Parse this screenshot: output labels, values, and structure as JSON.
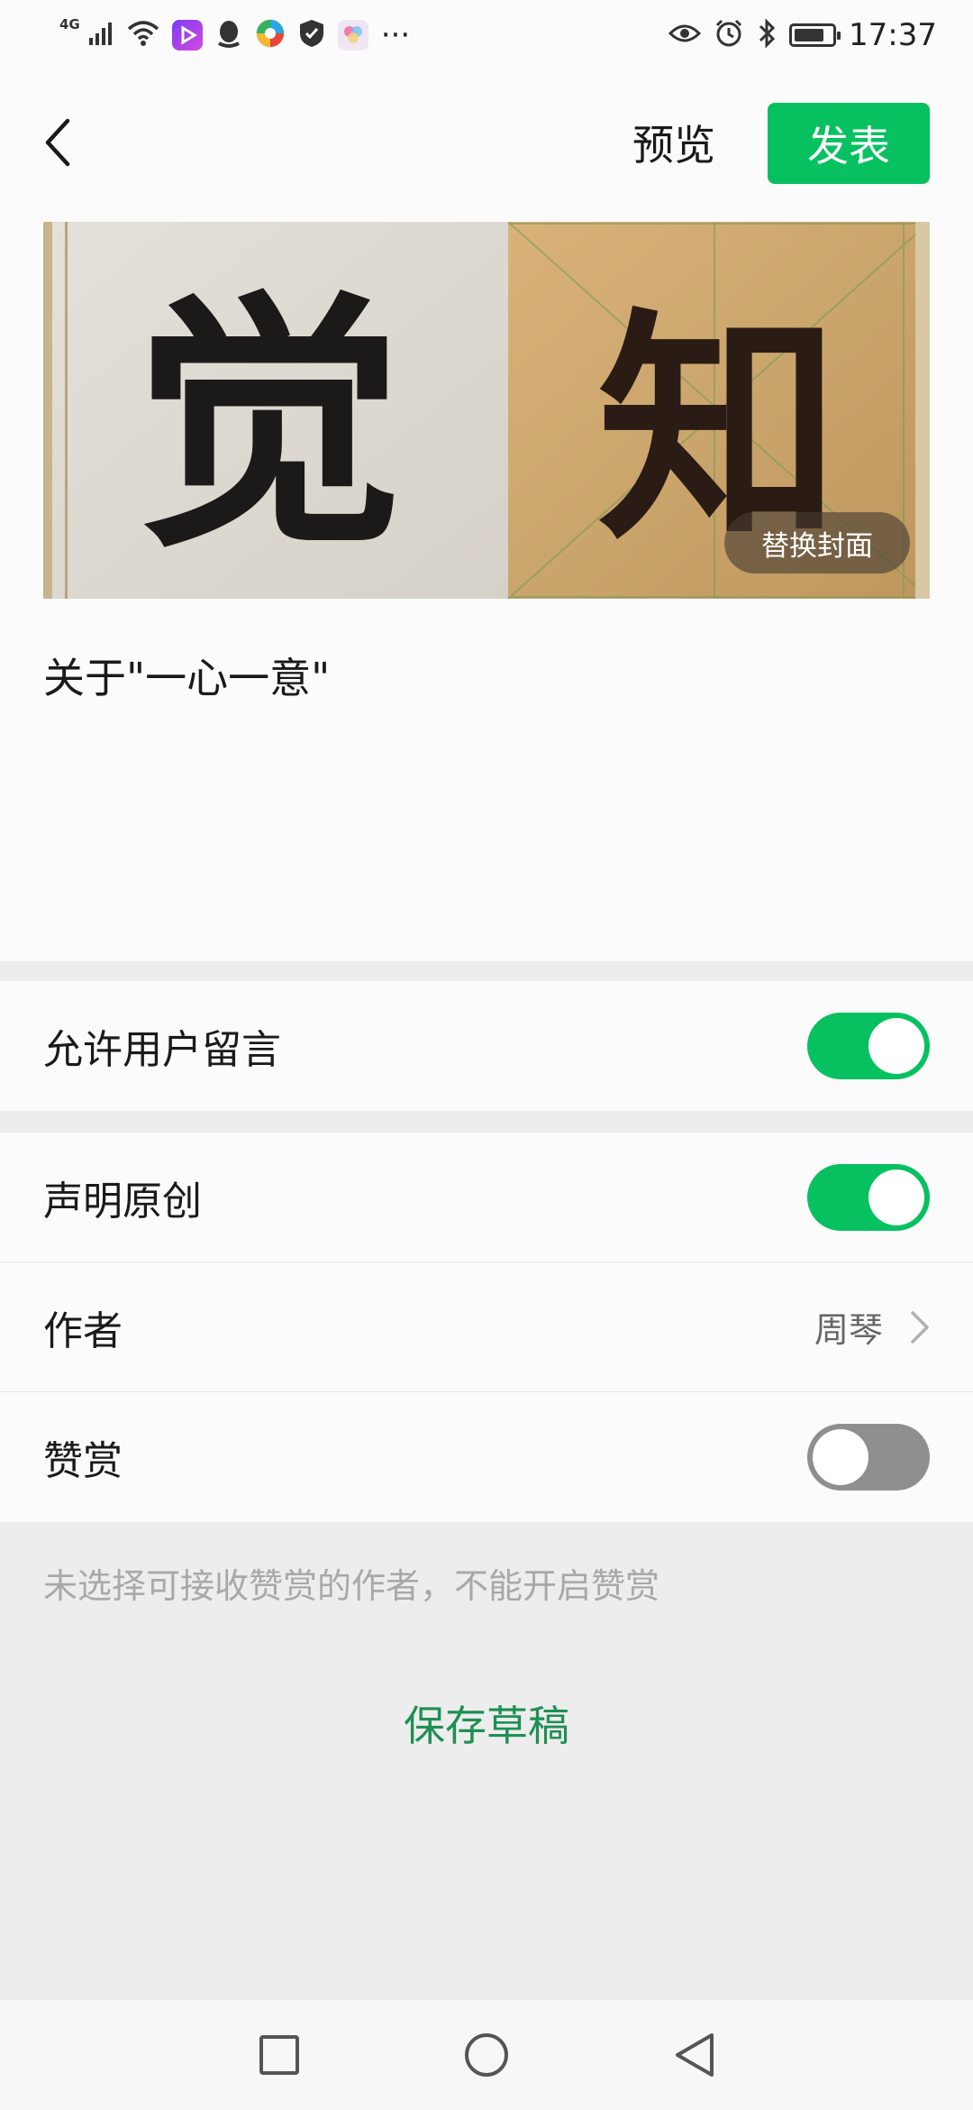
{
  "status_bar": {
    "network": "4G",
    "time": "17:37",
    "more": "···",
    "icons": [
      "signal-icon",
      "wifi-icon",
      "video-app-icon",
      "qq-icon",
      "browser-icon",
      "shield-icon",
      "gallery-icon",
      "eye-icon",
      "alarm-icon",
      "bluetooth-icon",
      "battery-icon"
    ]
  },
  "nav": {
    "back_icon": "chevron-left-icon",
    "preview_label": "预览",
    "publish_label": "发表"
  },
  "cover": {
    "replace_label": "替换封面",
    "left_char": "觉",
    "right_char": "知"
  },
  "article": {
    "title": "关于\"一心一意\""
  },
  "settings": {
    "allow_comments": {
      "label": "允许用户留言",
      "enabled": true
    },
    "declare_original": {
      "label": "声明原创",
      "enabled": true
    },
    "author": {
      "label": "作者",
      "value": "周琴"
    },
    "reward": {
      "label": "赞赏",
      "enabled": false
    }
  },
  "hint": "未选择可接收赞赏的作者，不能开启赞赏",
  "save_draft_label": "保存草稿",
  "colors": {
    "accent": "#07c160",
    "save_draft": "#1f8f55",
    "toggle_off": "#8f8f8f"
  }
}
